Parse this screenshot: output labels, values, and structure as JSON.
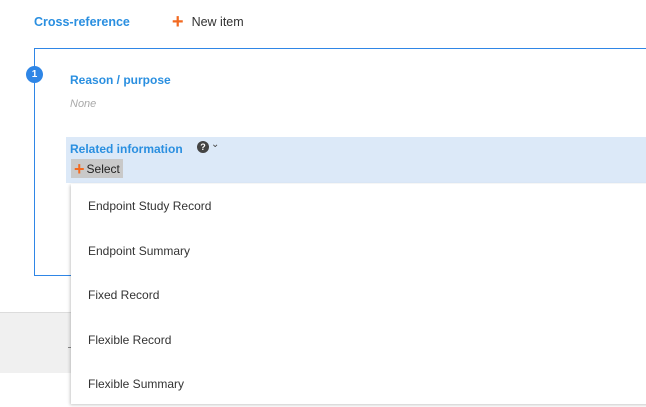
{
  "toolbar": {
    "cross_reference": "Cross-reference",
    "new_item": "New item"
  },
  "card": {
    "index": "1",
    "reason_label": "Reason / purpose",
    "reason_value": "None",
    "related_label": "Related information",
    "help_icon_glyph": "?",
    "select_label": "Select"
  },
  "dropdown": {
    "options": [
      "Endpoint Study Record",
      "Endpoint Summary",
      "Fixed Record",
      "Flexible Record",
      "Flexible Summary"
    ]
  },
  "colors": {
    "accent_blue": "#2a8fe0",
    "plus_orange": "#f26a21",
    "related_bg": "#dce9f8"
  },
  "icons": [
    "plus-icon",
    "help-icon",
    "chevron-down-icon"
  ]
}
